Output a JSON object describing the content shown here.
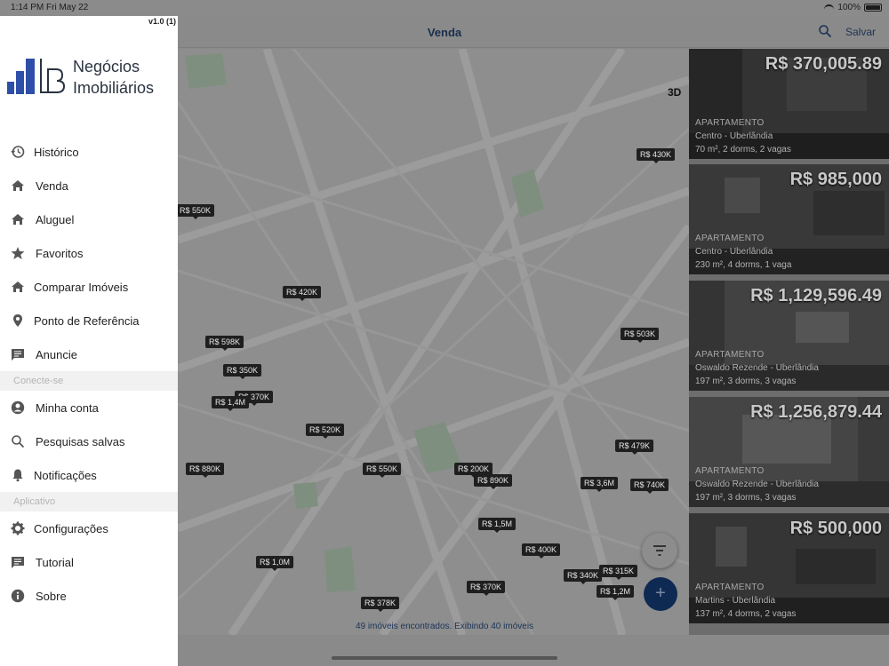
{
  "status_bar": {
    "time": "1:14 PM",
    "date": "Fri May 22",
    "battery": "100%"
  },
  "nav": {
    "title": "Venda",
    "save_label": "Salvar"
  },
  "map": {
    "label_3d": "3D",
    "price_pins": [
      "R$ 550K",
      "R$ 430K",
      "R$ 420K",
      "R$ 598K",
      "R$ 350K",
      "R$ 370K",
      "R$ 1,4M",
      "R$ 520K",
      "R$ 503K",
      "R$ 880K",
      "R$ 550K",
      "R$ 200K",
      "R$ 890K",
      "R$ 3,6M",
      "R$ 479K",
      "R$ 740K",
      "R$ 1,5M",
      "R$ 400K",
      "R$ 1,0M",
      "R$ 340K",
      "R$ 315K",
      "R$ 1,2M",
      "R$ 370K",
      "R$ 378K"
    ]
  },
  "footer": {
    "count_text": "49 imóveis encontrados. Exibindo 40 imóveis"
  },
  "listings": [
    {
      "price": "R$ 370,005.89",
      "type": "APARTAMENTO",
      "location": "Centro - Uberlândia",
      "details": "70 m², 2 dorms, 2 vagas"
    },
    {
      "price": "R$ 985,000",
      "type": "APARTAMENTO",
      "location": "Centro - Uberlândia",
      "details": "230 m², 4 dorms, 1 vaga"
    },
    {
      "price": "R$ 1,129,596.49",
      "type": "APARTAMENTO",
      "location": "Oswaldo Rezende - Uberlândia",
      "details": "197 m², 3 dorms, 3 vagas"
    },
    {
      "price": "R$ 1,256,879.44",
      "type": "APARTAMENTO",
      "location": "Oswaldo Rezende - Uberlândia",
      "details": "197 m², 3 dorms, 3 vagas"
    },
    {
      "price": "R$ 500,000",
      "type": "APARTAMENTO",
      "location": "Martins - Uberlândia",
      "details": "137 m², 4 dorms, 2 vagas"
    }
  ],
  "drawer": {
    "version": "v1.0 (1)",
    "logo": {
      "line1": "Negócios",
      "line2": "Imobiliários"
    },
    "items": [
      {
        "label": "Histórico",
        "icon": "history-icon"
      },
      {
        "label": "Venda",
        "icon": "home-icon"
      },
      {
        "label": "Aluguel",
        "icon": "home-icon"
      },
      {
        "label": "Favoritos",
        "icon": "star-icon"
      },
      {
        "label": "Comparar Imóveis",
        "icon": "home-icon"
      },
      {
        "label": "Ponto de Referência",
        "icon": "location-pin-icon"
      }
    ],
    "item_anuncie": {
      "label": "Anuncie",
      "icon": "message-icon"
    },
    "section_connect": "Conecte-se",
    "connect_items": [
      {
        "label": "Minha conta",
        "icon": "account-icon"
      },
      {
        "label": "Pesquisas salvas",
        "icon": "search-icon"
      },
      {
        "label": "Notificações",
        "icon": "bell-icon"
      }
    ],
    "section_app": "Aplicativo",
    "app_items": [
      {
        "label": "Configurações",
        "icon": "gear-icon"
      },
      {
        "label": "Tutorial",
        "icon": "message-icon"
      },
      {
        "label": "Sobre",
        "icon": "info-icon"
      }
    ]
  }
}
